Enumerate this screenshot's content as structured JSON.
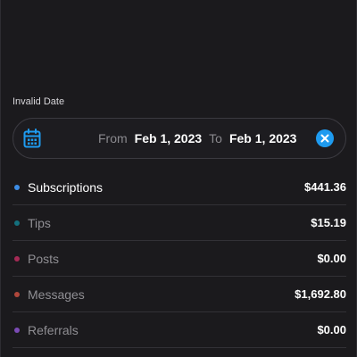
{
  "date_filter": {
    "caption": "Invalid Date",
    "from_label": "From",
    "from_date": "Feb 1, 2023",
    "to_label": "To",
    "to_date": "Feb 1, 2023"
  },
  "colors": {
    "accent": "#1e9bf0",
    "background": "#1b1a1d"
  },
  "icons": {
    "calendar": "calendar-icon",
    "clear": "clear-icon"
  },
  "earnings": [
    {
      "label": "Subscriptions",
      "amount": "$441.36",
      "dot_color": "#3d8de6",
      "active": true
    },
    {
      "label": "Tips",
      "amount": "$15.19",
      "dot_color": "#14707d",
      "active": false
    },
    {
      "label": "Posts",
      "amount": "$0.00",
      "dot_color": "#a52a55",
      "active": false
    },
    {
      "label": "Messages",
      "amount": "$1,692.80",
      "dot_color": "#b0473b",
      "active": false
    },
    {
      "label": "Referrals",
      "amount": "$0.00",
      "dot_color": "#7b4bb5",
      "active": false
    }
  ]
}
